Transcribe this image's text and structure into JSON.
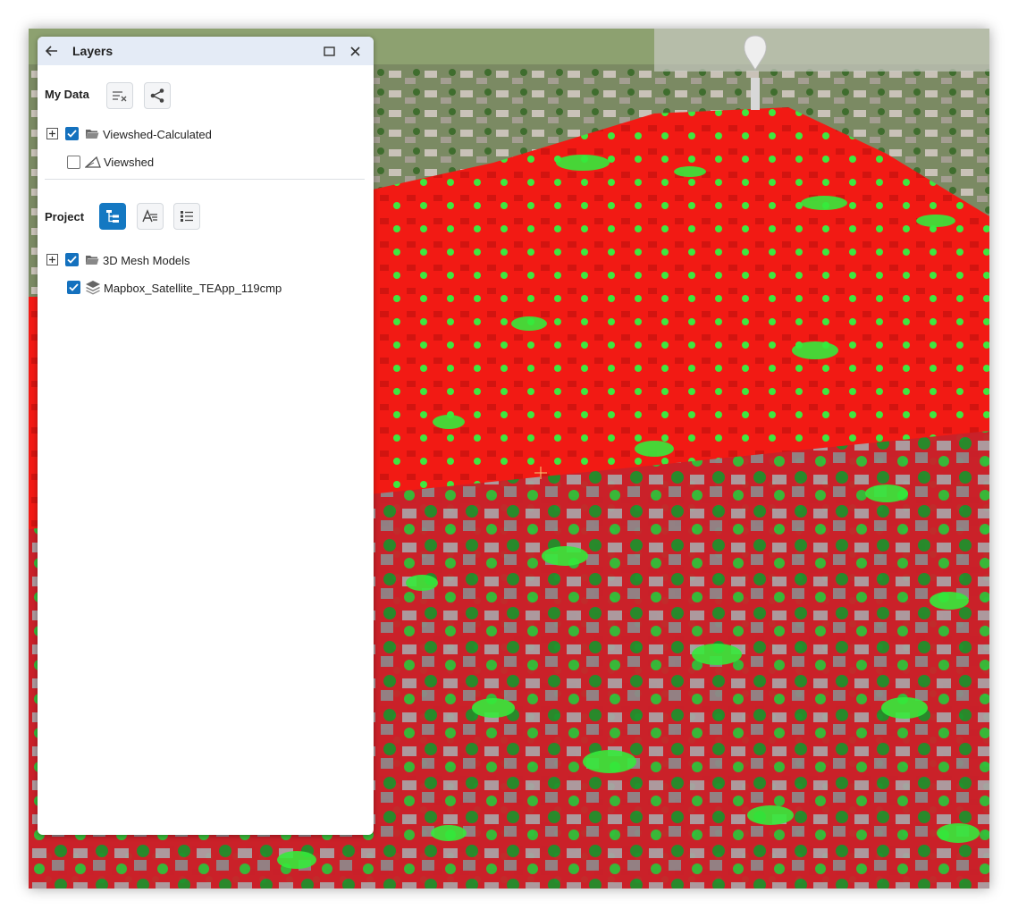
{
  "panel": {
    "title": "Layers",
    "back_icon": "arrow-left-icon",
    "maximize_icon": "maximize-icon",
    "close_icon": "close-icon"
  },
  "my_data": {
    "label": "My Data",
    "tools": [
      {
        "name": "clear-list-icon"
      },
      {
        "name": "share-icon"
      }
    ],
    "layers": [
      {
        "label": "Viewshed-Calculated",
        "checked": true,
        "expandable": true,
        "icon": "folder-icon"
      },
      {
        "label": "Viewshed",
        "checked": false,
        "expandable": false,
        "icon": "viewshed-icon"
      }
    ]
  },
  "project": {
    "label": "Project",
    "tools": [
      {
        "name": "tree-view-icon",
        "active": true
      },
      {
        "name": "text-style-icon",
        "active": false
      },
      {
        "name": "list-view-icon",
        "active": false
      }
    ],
    "layers": [
      {
        "label": "3D Mesh Models",
        "checked": true,
        "expandable": true,
        "icon": "folder-icon"
      },
      {
        "label": "Mapbox_Satellite_TEApp_119cmp",
        "checked": true,
        "expandable": false,
        "icon": "layers-stack-icon"
      }
    ]
  },
  "colors": {
    "visible": "#22e82a",
    "hidden": "#ff1a12",
    "accent": "#1478c2",
    "header_bg": "#e4ebf6"
  }
}
